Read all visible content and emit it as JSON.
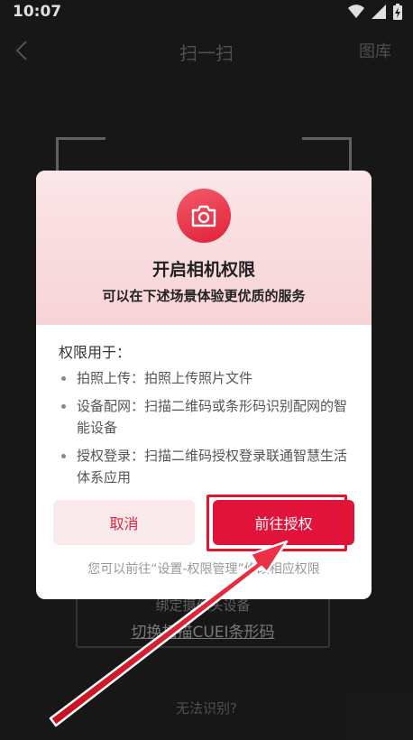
{
  "status": {
    "time": "10:07"
  },
  "header": {
    "title": "扫一扫",
    "gallery": "图库"
  },
  "background": {
    "bind_camera": "绑定摄像头设备",
    "switch_scan": "切换扫描CUEI条形码",
    "cant_scan": "无法识别?"
  },
  "dialog": {
    "title": "开启相机权限",
    "subtitle": "可以在下述场景体验更优质的服务",
    "perm_heading": "权限用于：",
    "items": [
      {
        "text": "拍照上传：拍照上传照片文件"
      },
      {
        "text": "设备配网：扫描二维码或条形码识别配网的智能设备"
      },
      {
        "text": "授权登录：扫描二维码授权登录联通智慧生活体系应用"
      }
    ],
    "cancel": "取消",
    "confirm": "前往授权",
    "note": "您可以前往“设置-权限管理”修改相应权限"
  },
  "colors": {
    "accent": "#e2133a",
    "header_bg": "#f7d3d7"
  },
  "icons": [
    "wifi-icon",
    "signal-icon",
    "battery-icon",
    "back-icon",
    "camera-icon"
  ]
}
